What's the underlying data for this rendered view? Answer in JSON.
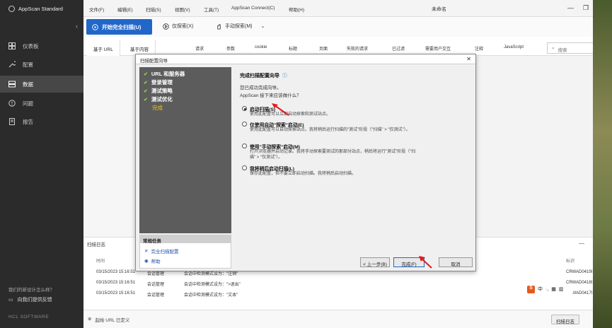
{
  "app": {
    "brand": "AppScan Standard",
    "window_title": "未命名"
  },
  "menu": [
    "文件(F)",
    "编辑(E)",
    "扫描(S)",
    "视图(V)",
    "工具(T)",
    "AppScan Connect(C)",
    "帮助(H)"
  ],
  "sidebar": {
    "items": [
      {
        "label": "仪表板",
        "icon": "dashboard-icon"
      },
      {
        "label": "配置",
        "icon": "wrench-icon"
      },
      {
        "label": "数据",
        "icon": "database-icon",
        "active": true
      },
      {
        "label": "问题",
        "icon": "issue-icon"
      },
      {
        "label": "报告",
        "icon": "report-icon"
      }
    ],
    "help_text": "我们的新设计怎么样？",
    "feedback": "向我们提供反馈",
    "footer": "HCL SOFTWARE"
  },
  "toolbar": {
    "start_full_scan": "开始完全扫描(U)",
    "explore_only": "仅探索(X)",
    "manual_explore": "手动探索(M)"
  },
  "tabs": {
    "left": [
      "基于 URL",
      "基于内容"
    ],
    "filters": [
      "请求",
      "参数",
      "cookie",
      "标题",
      "页面",
      "失败的请求",
      "已过滤",
      "需要用户交互",
      "注释",
      "JavaScript"
    ],
    "search_placeholder": "搜索"
  },
  "scan_log": {
    "title": "扫描日志",
    "col_time": "时间",
    "col_id": "标识",
    "rows": [
      {
        "time": "03/15/2023 15:16:51",
        "type": "会话管理",
        "msg": "会话中检测模式设为：\"注销\"",
        "id": "CRWAD0419I"
      },
      {
        "time": "03/15/2023 15:16:51",
        "type": "会话管理",
        "msg": "会话中检测模式设为：\">退出\"",
        "id": "CRWAD0418I"
      },
      {
        "time": "03/15/2023 15:16:51",
        "type": "会话管理",
        "msg": "会话中检测模式设为：\"文本\"",
        "id": "CRWAD0417I"
      }
    ]
  },
  "statusbar": {
    "base_url": "起始 URL 已定义",
    "scan_log_button": "扫描日志"
  },
  "dialog": {
    "title": "扫描配置向导",
    "steps": [
      {
        "label": "URL 和服务器",
        "done": true
      },
      {
        "label": "登录管理",
        "done": true
      },
      {
        "label": "测试策略",
        "done": true
      },
      {
        "label": "测试优化",
        "done": true
      },
      {
        "label": "完成",
        "done": false
      }
    ],
    "tasks_title": "常规任务",
    "tasks": [
      "完全扫描配置",
      "帮助"
    ],
    "heading": "完成扫描配置向导",
    "intro1": "您已成功完成向导。",
    "intro2": "AppScan 接下来应该做什么？",
    "options": [
      {
        "label": "启动扫描(S)",
        "desc": "使用此配置可以立即启动探索和测试站点。",
        "selected": true
      },
      {
        "label": "仅使用自动\"探索\"启动(E)",
        "desc": "使用此配置可以自动探索站点。我将稍后运行扫描的\"测试\"阶段（\"扫描\" > \"仅测试\"）。",
        "selected": false
      },
      {
        "label": "使用\"手动探索\"启动(M)",
        "desc": "打开浏览器并启动记录。我将手动探索要测试的那部分站点，稍后将运行\"测试\"阶段（\"扫描\" > \"仅测试\"）。",
        "selected": false
      },
      {
        "label": "我将稍后启动扫描(L)",
        "desc": "保存此配置，但不要立即启动扫描。我将稍后启动扫描。",
        "selected": false
      }
    ],
    "btn_back": "< 上一步(B)",
    "btn_finish": "完成(F)",
    "btn_cancel": "取消"
  },
  "ime": {
    "logo": "S",
    "lang": "中"
  }
}
